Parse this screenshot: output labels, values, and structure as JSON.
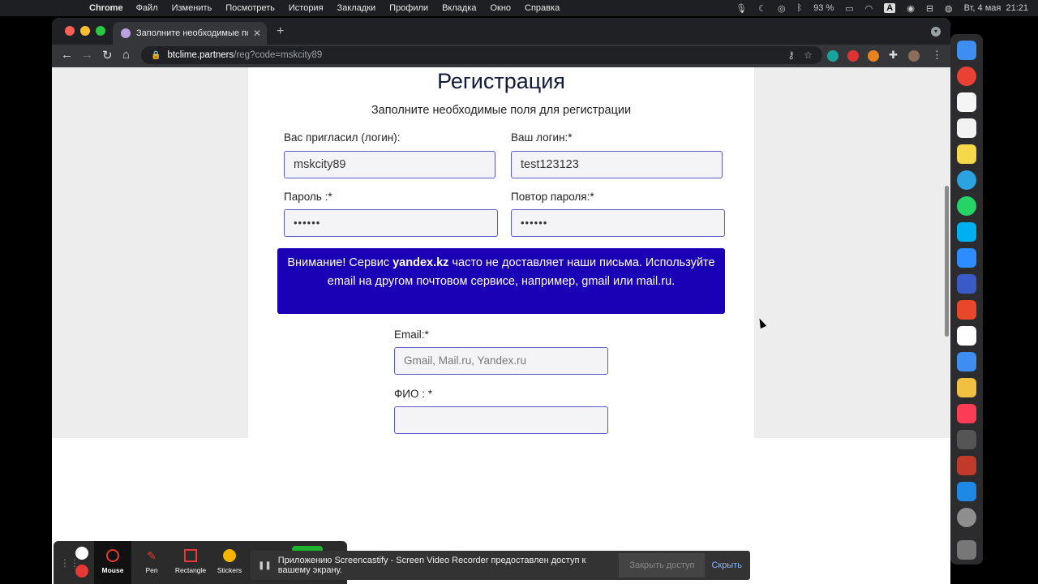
{
  "menubar": {
    "app": "Chrome",
    "items": [
      "Файл",
      "Изменить",
      "Посмотреть",
      "История",
      "Закладки",
      "Профили",
      "Вкладка",
      "Окно",
      "Справка"
    ],
    "battery": "93 %",
    "clock": "Вт, 4 мая  21:21",
    "keyboard": "A"
  },
  "browser": {
    "tab_title": "Заполните необходимые поля",
    "url_host": "btclime.partners",
    "url_path": "/reg?code=mskcity89"
  },
  "page": {
    "title": "Регистрация",
    "subtitle": "Заполните необходимые поля для регистрации",
    "inviter_label": "Вас пригласил (логин):",
    "inviter_value": "mskcity89",
    "login_label": "Ваш логин:*",
    "login_value": "test123123",
    "password_label": "Пароль :*",
    "password_value": "••••••",
    "password_repeat_label": "Повтор пароля:*",
    "password_repeat_value": "••••••",
    "alert_prefix": "Внимание! Сервис ",
    "alert_bold": "yandex.kz",
    "alert_suffix": " часто не доставляет наши письма. Используйте email на другом почтовом сервисе, например, gmail или mail.ru.",
    "email_label": "Email:*",
    "email_placeholder": "Gmail, Mail.ru, Yandex.ru",
    "fio_label": "ФИО : *"
  },
  "recorder": {
    "mouse": "Mouse",
    "pen": "Pen",
    "rectangle": "Rectangle",
    "stickers": "Stickers"
  },
  "notice": {
    "message": "Приложению Screencastify - Screen Video Recorder предоставлен доступ к вашему экрану.",
    "grant": "Закрыть доступ",
    "hide": "Скрыть"
  },
  "colors": {
    "alert_bg": "#1a01b5",
    "input_border": "#5a5ac8"
  }
}
